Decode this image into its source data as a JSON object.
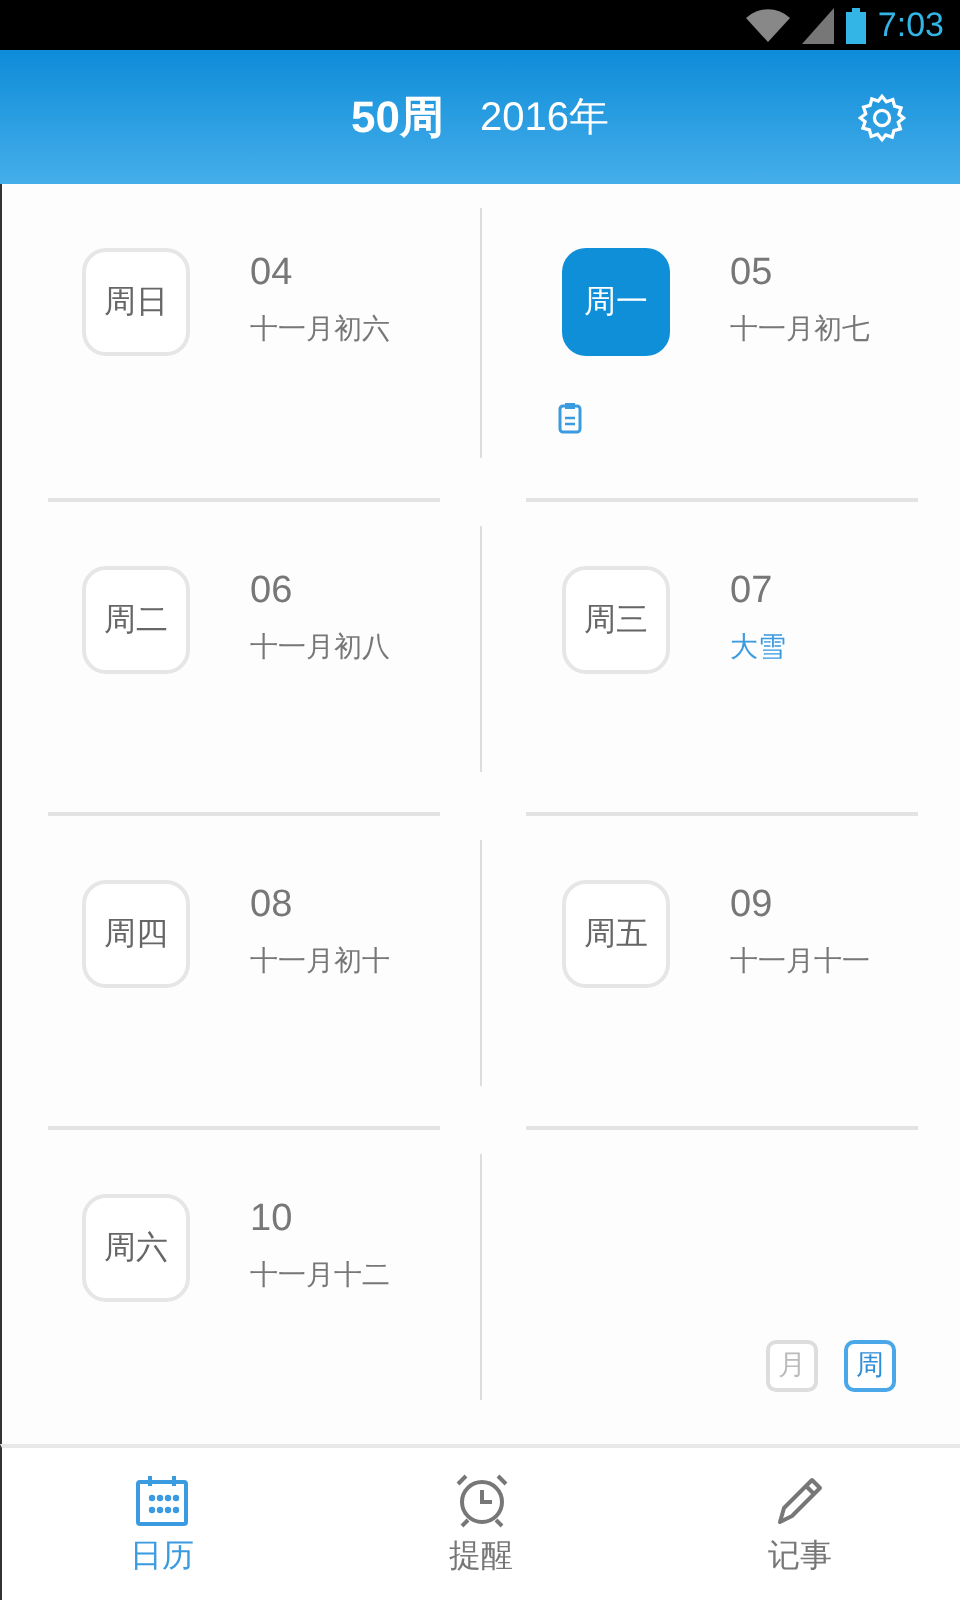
{
  "status_bar": {
    "time": "7:03"
  },
  "header": {
    "week": "50周",
    "year": "2016年"
  },
  "days": [
    {
      "weekday": "周日",
      "date": "04",
      "lunar": "十一月初六",
      "selected": false,
      "highlight": false,
      "has_note": false
    },
    {
      "weekday": "周一",
      "date": "05",
      "lunar": "十一月初七",
      "selected": true,
      "highlight": false,
      "has_note": true
    },
    {
      "weekday": "周二",
      "date": "06",
      "lunar": "十一月初八",
      "selected": false,
      "highlight": false,
      "has_note": false
    },
    {
      "weekday": "周三",
      "date": "07",
      "lunar": "大雪",
      "selected": false,
      "highlight": true,
      "has_note": false
    },
    {
      "weekday": "周四",
      "date": "08",
      "lunar": "十一月初十",
      "selected": false,
      "highlight": false,
      "has_note": false
    },
    {
      "weekday": "周五",
      "date": "09",
      "lunar": "十一月十一",
      "selected": false,
      "highlight": false,
      "has_note": false
    },
    {
      "weekday": "周六",
      "date": "10",
      "lunar": "十一月十二",
      "selected": false,
      "highlight": false,
      "has_note": false
    }
  ],
  "view_toggle": [
    {
      "label": "月",
      "selected": false
    },
    {
      "label": "周",
      "selected": true
    }
  ],
  "nav": [
    {
      "label": "日历",
      "kind": "calendar",
      "selected": true
    },
    {
      "label": "提醒",
      "kind": "alarm",
      "selected": false
    },
    {
      "label": "记事",
      "kind": "pencil",
      "selected": false
    }
  ]
}
